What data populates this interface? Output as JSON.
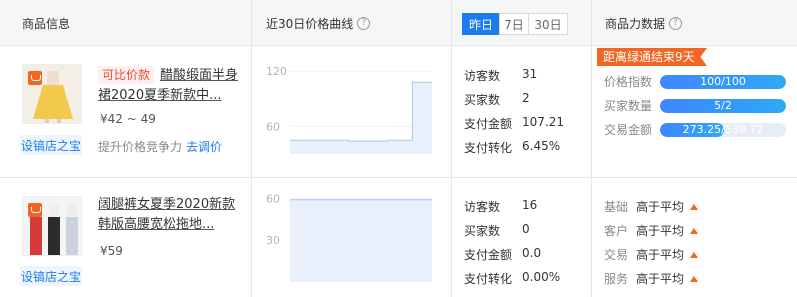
{
  "header": {
    "product_info": "商品信息",
    "price_curve": "近30日价格曲线",
    "period_options": [
      "昨日",
      "7日",
      "30日"
    ],
    "period_selected": "昨日",
    "power_data": "商品力数据",
    "help_glyph": "?"
  },
  "rows": [
    {
      "thumb_color_top": "#f3efe6",
      "thumb_color_skirt": "#f2c94c",
      "shop_tag": "设镐店之宝",
      "compare_tag": "可比价款",
      "title": "醋酸缎面半身裙2020夏季新款中...",
      "price": "¥42 ~ 49",
      "hint": "提升价格竞争力",
      "hint_link": "去调价",
      "chart": {
        "y_ticks": [
          "120",
          "60"
        ],
        "y_tick_values": [
          120,
          60
        ],
        "y_range": [
          30,
          130
        ],
        "series": [
          45,
          45,
          45,
          45,
          45,
          45,
          45,
          45,
          45,
          45,
          45,
          45,
          44,
          44,
          44,
          44,
          44,
          44,
          44,
          44,
          45,
          45,
          45,
          45,
          45,
          108,
          108,
          108,
          108,
          108
        ]
      },
      "metrics": [
        {
          "label": "访客数",
          "value": "31"
        },
        {
          "label": "买家数",
          "value": "2"
        },
        {
          "label": "支付金额",
          "value": "107.21"
        },
        {
          "label": "支付转化",
          "value": "6.45%"
        }
      ],
      "countdown": "距离绿通结束9天",
      "power_bars": [
        {
          "label": "价格指数",
          "text": "100/100",
          "fill": 1.0
        },
        {
          "label": "买家数量",
          "text": "5/2",
          "fill": 1.0
        },
        {
          "label": "交易金额",
          "text": "273.25/539.72",
          "fill": 0.51
        }
      ]
    },
    {
      "thumb_color_top": "#f4f4f4",
      "thumb_color_skirt": "#d63b3b",
      "shop_tag": "设镐店之宝",
      "title": "阔腿裤女夏季2020新款韩版高腰宽松拖地...",
      "price": "¥59",
      "chart": {
        "y_ticks": [
          "60",
          "30"
        ],
        "y_tick_values": [
          60,
          30
        ],
        "y_range": [
          0,
          66
        ],
        "series": [
          59,
          59,
          59,
          59,
          59,
          59,
          59,
          59,
          59,
          59,
          59,
          59,
          59,
          59,
          59,
          59,
          59,
          59,
          59,
          59,
          59,
          59,
          59,
          59,
          59,
          59,
          59,
          59,
          59,
          59
        ]
      },
      "metrics": [
        {
          "label": "访客数",
          "value": "16"
        },
        {
          "label": "买家数",
          "value": "0"
        },
        {
          "label": "支付金额",
          "value": "0.0"
        },
        {
          "label": "支付转化",
          "value": "0.00%"
        }
      ],
      "compare": [
        {
          "label": "基础",
          "value": "高于平均"
        },
        {
          "label": "客户",
          "value": "高于平均"
        },
        {
          "label": "交易",
          "value": "高于平均"
        },
        {
          "label": "服务",
          "value": "高于平均"
        }
      ]
    }
  ]
}
